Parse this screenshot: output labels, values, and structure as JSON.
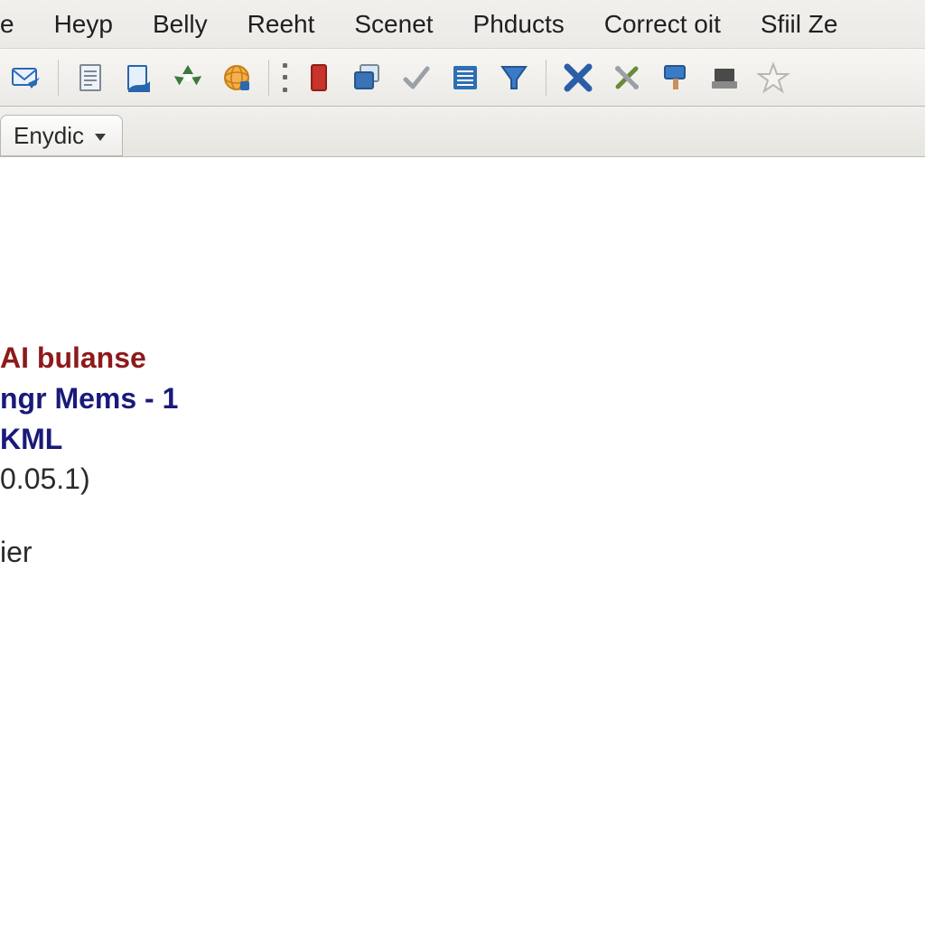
{
  "menubar": {
    "items": [
      "e",
      "Heyp",
      "Belly",
      "Reeht",
      "Scenet",
      "Phducts",
      "Correct oit",
      "Sfiil Ze"
    ]
  },
  "toolbar": {
    "icons": [
      "mail-send-icon",
      "document-icon",
      "page-export-icon",
      "recycle-icon",
      "globe-icon",
      "grip-icon",
      "flag-red-icon",
      "windows-icon",
      "checkmark-icon",
      "list-icon",
      "funnel-icon",
      "close-x-icon",
      "crossed-tools-icon",
      "paint-icon",
      "device-icon",
      "star-icon"
    ]
  },
  "tab": {
    "label": "Enydic"
  },
  "content": {
    "line1": "AI bulanse",
    "line2": "ngr Mems - 1",
    "line3": "KML",
    "line4": "0.05.1)",
    "line5": "ier"
  }
}
